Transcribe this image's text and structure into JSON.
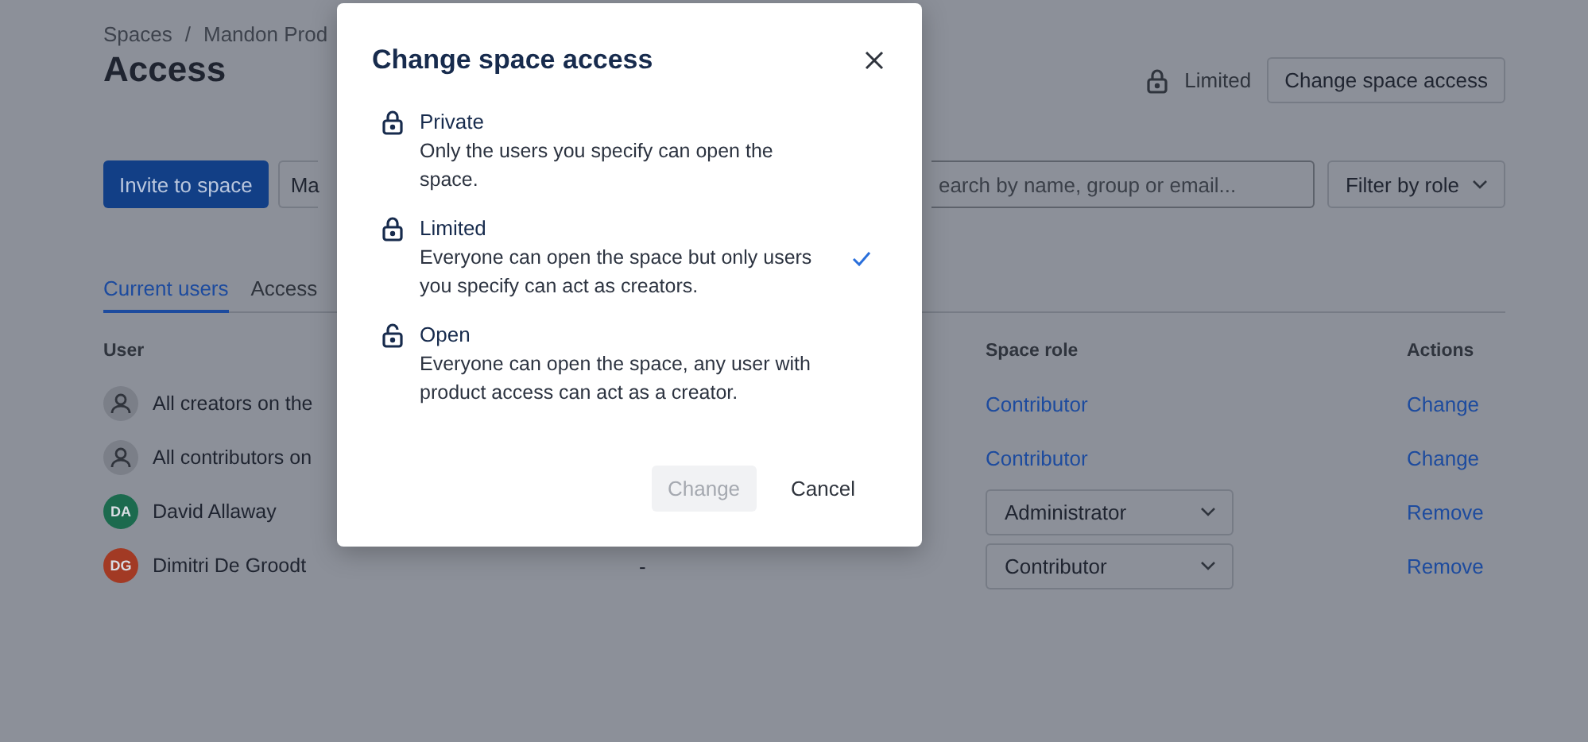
{
  "breadcrumb": {
    "items": [
      "Spaces",
      "Mandon Prod"
    ],
    "separator": "/"
  },
  "title": "Access",
  "access_status": {
    "label": "Limited",
    "locked": true
  },
  "header_button": "Change space access",
  "toolbar": {
    "invite_button": "Invite to space",
    "button_2": "Ma",
    "search": {
      "placeholder": "earch by name, group or email..."
    },
    "filter_button": "Filter by role"
  },
  "tabs": [
    {
      "label": "Current users",
      "selected": true
    },
    {
      "label": "Access",
      "selected": false
    }
  ],
  "table": {
    "columns": [
      "User",
      "Space role",
      "Actions"
    ],
    "rows": [
      {
        "kind": "group",
        "user": "All creators on the",
        "role": {
          "kind": "link",
          "text": "Contributor"
        },
        "action": "Change"
      },
      {
        "kind": "group",
        "user": "All contributors on",
        "role": {
          "kind": "link",
          "text": "Contributor"
        },
        "action": "Change"
      },
      {
        "kind": "person",
        "initials": "DA",
        "color": "#1c6a4e",
        "user": "David Allaway",
        "role": {
          "kind": "select",
          "text": "Administrator"
        },
        "action": "Remove"
      },
      {
        "kind": "person",
        "initials": "DG",
        "color": "#a23a24",
        "user": "Dimitri De Groodt",
        "column_2": "-",
        "role": {
          "kind": "select",
          "text": "Contributor"
        },
        "action": "Remove"
      }
    ]
  },
  "modal": {
    "title": "Change space access",
    "options": [
      {
        "label": "Private",
        "description": "Only the users you specify can open the space.",
        "locked": true,
        "selected": false
      },
      {
        "label": "Limited",
        "description": "Everyone can open the space but only users you specify can act as creators.",
        "locked": true,
        "selected": true
      },
      {
        "label": "Open",
        "description": "Everyone can open the space, any user with product access can act as a creator.",
        "locked": false,
        "selected": false
      }
    ],
    "confirm_button": {
      "label": "Change",
      "disabled": true
    },
    "cancel_button": "Cancel"
  }
}
